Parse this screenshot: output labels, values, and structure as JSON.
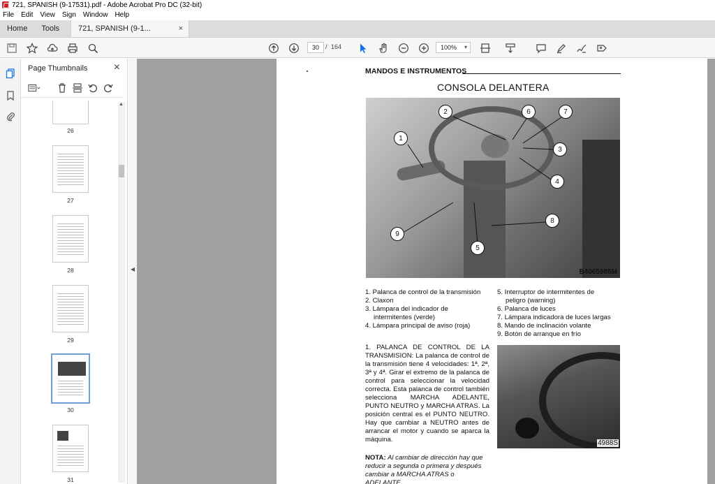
{
  "window": {
    "title": "721, SPANISH (9-17531).pdf - Adobe Acrobat Pro DC (32-bit)"
  },
  "menu": [
    "File",
    "Edit",
    "View",
    "Sign",
    "Window",
    "Help"
  ],
  "tabs": {
    "home": "Home",
    "tools": "Tools",
    "document": "721, SPANISH (9-1...",
    "close": "×"
  },
  "toolbar": {
    "current_page": "30",
    "page_separator": "/",
    "total_pages": "164",
    "zoom": "100%",
    "icons": [
      "save-icon",
      "star-icon",
      "upload-icon",
      "print-icon",
      "find-icon",
      "page-up-icon",
      "page-down-icon",
      "select-cursor-icon",
      "hand-icon",
      "zoom-out-icon",
      "zoom-in-icon",
      "fit-page-icon",
      "scroll-mode-icon",
      "comment-icon",
      "highlight-icon",
      "sign-icon",
      "fill-sign-icon"
    ]
  },
  "panel": {
    "title": "Page Thumbnails",
    "close": "×",
    "thumbnails": [
      {
        "label": "26",
        "selected": false
      },
      {
        "label": "27",
        "selected": false
      },
      {
        "label": "28",
        "selected": false
      },
      {
        "label": "29",
        "selected": false
      },
      {
        "label": "30",
        "selected": true
      },
      {
        "label": "31",
        "selected": false
      }
    ]
  },
  "page": {
    "header": "MANDOS E INSTRUMENTOS",
    "title": "CONSOLA DELANTERA",
    "photo1_code": "B4065988M",
    "photo2_code": "4988S",
    "callouts": [
      "1",
      "2",
      "3",
      "4",
      "5",
      "6",
      "7",
      "8",
      "9"
    ],
    "legend_left": [
      "1. Palanca de control de la transmisión",
      "2. Claxon",
      "3. Lámpara del indicador de",
      "    intermitentes (verde)",
      "4. Lámpara principal de aviso (roja)"
    ],
    "legend_right": [
      "5. Interruptor   de   intermitentes   de",
      "    peligro (warning)",
      "6. Palanca de luces",
      "7. Lámpara indicadora de luces largas",
      "8. Mando de inclinación volante",
      "9. Botón de arranque en frío"
    ],
    "paragraph": "1. PALANCA DE CONTROL DE LA TRANSMISION: La palanca de control de la transmisión tiene 4 velocidades: 1ª, 2ª, 3ª y 4ª. Girar el extremo de la palanca de control para seleccionar la velocidad correcta. Esta palanca de control también selecciona MARCHA ADELANTE, PUNTO NEUTRO y MARCHA ATRAS. La posición central es el PUNTO NEUTRO. Hay que cambiar a NEUTRO antes de arrancar el motor y cuando se aparca la máquina.",
    "nota_label": "NOTA:",
    "nota_text": " Al cambiar de dirección hay que reducir a segunda o primera y después cambiar a MARCHA ATRAS o ADELANTE."
  }
}
